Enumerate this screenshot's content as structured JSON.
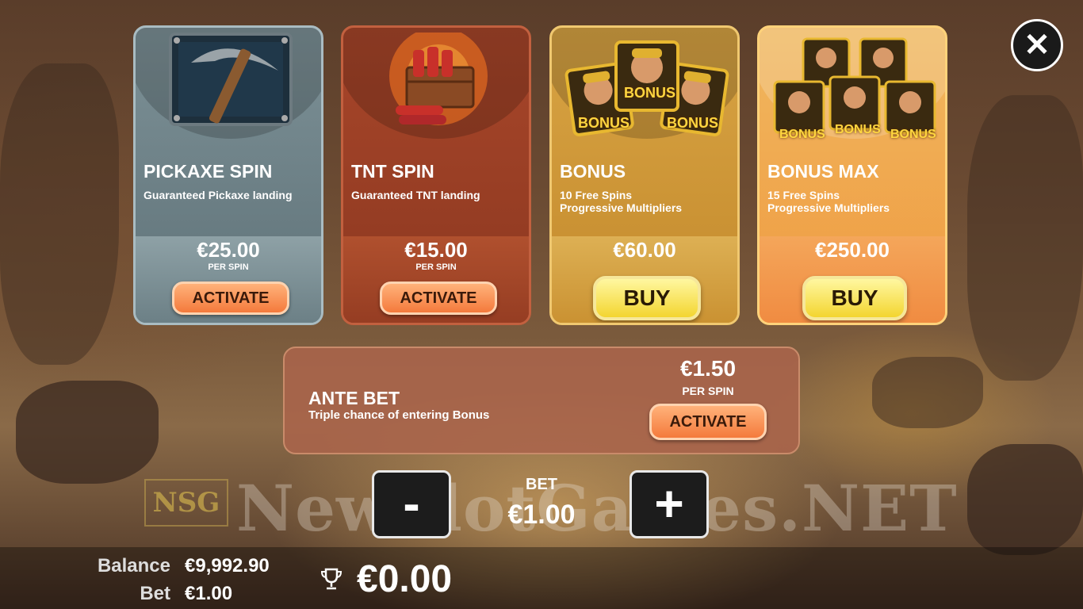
{
  "cards": [
    {
      "title": "PICKAXE SPIN",
      "description": "Guaranteed Pickaxe landing",
      "price": "€25.00",
      "per_spin": "PER SPIN",
      "button": "ACTIVATE"
    },
    {
      "title": "TNT SPIN",
      "description": "Guaranteed TNT landing",
      "price": "€15.00",
      "per_spin": "PER SPIN",
      "button": "ACTIVATE"
    },
    {
      "title": "BONUS",
      "description": "10 Free Spins\nProgressive Multipliers",
      "price": "€60.00",
      "button": "BUY",
      "art_text": "BONUS"
    },
    {
      "title": "BONUS MAX",
      "description": "15 Free Spins\nProgressive Multipliers",
      "price": "€250.00",
      "button": "BUY",
      "art_text": "BONUS"
    }
  ],
  "ante": {
    "title": "ANTE BET",
    "description": "Triple chance of entering Bonus",
    "price": "€1.50",
    "per_spin": "PER SPIN",
    "button": "ACTIVATE"
  },
  "bet_control": {
    "label": "BET",
    "value": "€1.00",
    "minus": "-",
    "plus": "+"
  },
  "footer": {
    "balance_label": "Balance",
    "balance_value": "€9,992.90",
    "bet_label": "Bet",
    "bet_value": "€1.00",
    "win_value": "€0.00"
  },
  "watermark": {
    "logo": "NSG",
    "text": "NewSlotGames.NET"
  },
  "close_symbol": "✕",
  "colors": {
    "pickaxe_card": "#6f8288",
    "tnt_card": "#9a3e24",
    "bonus_card": "#d9a23c",
    "bonus_max_card": "#f0a848",
    "activate": "#f47a3c",
    "buy": "#f3d530"
  }
}
